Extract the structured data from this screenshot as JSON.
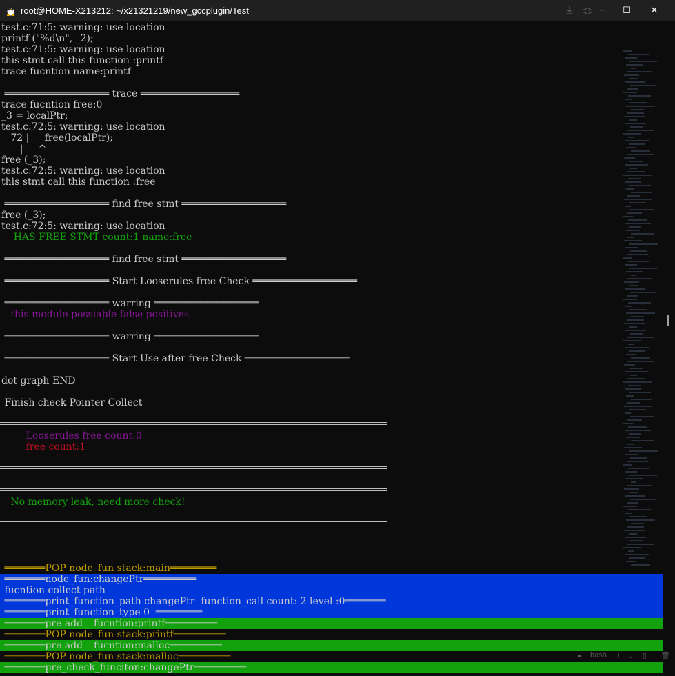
{
  "window": {
    "title": "root@HOME-X213212: ~/x21321219/new_gccplugin/Test",
    "controls": {
      "minimize": "─",
      "maximize": "☐",
      "close": "✕"
    }
  },
  "terminal": {
    "lines": [
      {
        "text": "test.c:71:5: warning: use location",
        "color": "#cccccc"
      },
      {
        "text": "printf (\"%d\\n\", _2);",
        "color": "#cccccc"
      },
      {
        "text": "test.c:71:5: warning: use location",
        "color": "#cccccc"
      },
      {
        "text": "this stmt call this function :printf",
        "color": "#cccccc"
      },
      {
        "text": "trace fucntion name:printf",
        "color": "#cccccc"
      },
      {
        "text": "",
        "color": "#cccccc"
      },
      {
        "text": " ══════════════════ trace ═════════════════",
        "color": "#cccccc"
      },
      {
        "text": "trace fucntion free:0",
        "color": "#cccccc"
      },
      {
        "text": "_3 = localPtr;",
        "color": "#cccccc"
      },
      {
        "text": "test.c:72:5: warning: use location",
        "color": "#cccccc"
      },
      {
        "text": "   72 |     free(localPtr);",
        "color": "#cccccc"
      },
      {
        "text": "      |     ^",
        "color": "#cccccc"
      },
      {
        "text": "free (_3);",
        "color": "#cccccc"
      },
      {
        "text": "test.c:72:5: warning: use location",
        "color": "#cccccc"
      },
      {
        "text": "this stmt call this function :free",
        "color": "#cccccc"
      },
      {
        "text": "",
        "color": "#cccccc"
      },
      {
        "text": " ══════════════════ find free stmt ══════════════════",
        "color": "#cccccc"
      },
      {
        "text": "free (_3);",
        "color": "#cccccc"
      },
      {
        "text": "test.c:72:5: warning: use location",
        "color": "#cccccc"
      },
      {
        "text": "    HAS FREE STMT count:1 name:free",
        "color": "#13a10e"
      },
      {
        "text": "",
        "color": "#cccccc"
      },
      {
        "text": " ══════════════════ find free stmt ══════════════════",
        "color": "#cccccc"
      },
      {
        "text": "",
        "color": "#cccccc"
      },
      {
        "text": " ══════════════════ Start Looserules free Check ══════════════════",
        "color": "#cccccc"
      },
      {
        "text": "",
        "color": "#cccccc"
      },
      {
        "text": " ══════════════════ warring ══════════════════",
        "color": "#cccccc"
      },
      {
        "text": "   this module possiable false positives",
        "color": "#881798"
      },
      {
        "text": "",
        "color": "#cccccc"
      },
      {
        "text": " ══════════════════ warring ══════════════════",
        "color": "#cccccc"
      },
      {
        "text": "",
        "color": "#cccccc"
      },
      {
        "text": " ══════════════════ Start Use after free Check ══════════════════",
        "color": "#cccccc"
      },
      {
        "text": "",
        "color": "#cccccc"
      },
      {
        "text": "dot graph END",
        "color": "#cccccc"
      },
      {
        "text": "",
        "color": "#cccccc"
      },
      {
        "text": " Finish check Pointer Collect",
        "color": "#cccccc"
      },
      {
        "text": "",
        "color": "#cccccc"
      },
      {
        "text": "",
        "color": "#cccccc"
      },
      {
        "text": "        Looserules free count:0",
        "color": "#881798"
      },
      {
        "text": "        free count:1",
        "color": "#c50f1f"
      },
      {
        "text": "",
        "color": "#cccccc"
      },
      {
        "text": "",
        "color": "#cccccc"
      },
      {
        "text": "",
        "color": "#cccccc"
      },
      {
        "text": "",
        "color": "#cccccc"
      },
      {
        "text": "   No memory leak, need more check!",
        "color": "#13a10e"
      },
      {
        "text": "",
        "color": "#cccccc"
      },
      {
        "text": "",
        "color": "#cccccc"
      },
      {
        "text": "",
        "color": "#cccccc"
      },
      {
        "text": "",
        "color": "#cccccc"
      },
      {
        "text": "",
        "color": "#cccccc"
      },
      {
        "text": " ═══════POP node_fun stack:main════════",
        "color": "#c19c00"
      },
      {
        "text": " ═══════node_fun:changePtr═════════",
        "color": "#cccccc",
        "band": "blue"
      },
      {
        "text": " fucntion collect path",
        "color": "#cccccc",
        "band": "blue"
      },
      {
        "text": " ═══════print_function_path changePtr  function_call count: 2 level :0═══════",
        "color": "#cccccc",
        "band": "blue"
      },
      {
        "text": " ═══════print_function_type 0  ════════",
        "color": "#cccccc",
        "band": "blue"
      },
      {
        "text": " ═══════pre add _ fucntion:printf═════════",
        "color": "#cccccc",
        "band": "green"
      },
      {
        "text": " ═══════POP node_fun stack:printf═════════",
        "color": "#c19c00"
      },
      {
        "text": " ═══════pre add _ fucntion:malloc═════════",
        "color": "#cccccc",
        "band": "green"
      },
      {
        "text": " ═══════POP node_fun stack:malloc═════════",
        "color": "#c19c00"
      },
      {
        "text": " ═══════pre_check_funciton:changePtr═════════",
        "color": "#cccccc",
        "band": "green"
      }
    ],
    "colors": {
      "background": "#0c0c0c",
      "foreground": "#cccccc",
      "blue_band": "#0037da",
      "green_band": "#13a10e"
    }
  },
  "bottom_tab": {
    "label": "bash",
    "add": "+",
    "dropdown": "⌄"
  }
}
